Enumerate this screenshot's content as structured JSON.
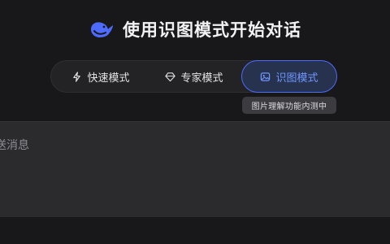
{
  "hero": {
    "title": "使用识图模式开始对话",
    "logo_icon": "whale-logo-icon",
    "brand_color": "#4d6bfe"
  },
  "modes": [
    {
      "label": "快速模式",
      "icon": "lightning-icon",
      "selected": false
    },
    {
      "label": "专家模式",
      "icon": "diamond-icon",
      "selected": false
    },
    {
      "label": "识图模式",
      "icon": "image-icon",
      "selected": true
    }
  ],
  "tooltip": {
    "text": "图片理解功能内测中"
  },
  "composer": {
    "placeholder": "送消息"
  },
  "colors": {
    "background": "#18181a",
    "accent": "#4d6bfe",
    "accent_text": "#6f96ff",
    "composer_bg": "#2b2b2e"
  }
}
